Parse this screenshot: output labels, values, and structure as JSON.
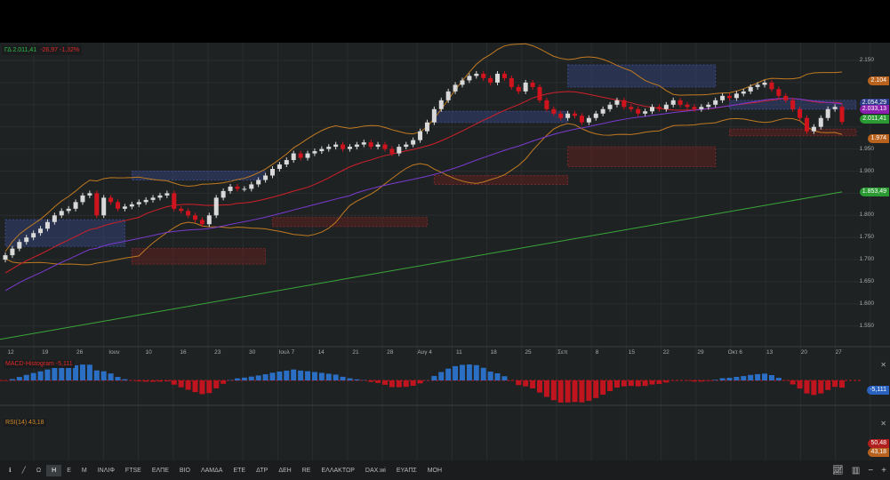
{
  "header": {
    "symbol_value": "ΓΔ 2.011,41",
    "change": "-26,97 -1,32%"
  },
  "price_axis": {
    "ticks": [
      "2.150",
      "1.950",
      "1.900",
      "1.800",
      "1.750",
      "1.700",
      "1.650",
      "1.600",
      "1.550"
    ],
    "tick_values": [
      2150,
      1950,
      1900,
      1800,
      1750,
      1700,
      1650,
      1600,
      1550
    ]
  },
  "price_tags": [
    {
      "text": "2.104",
      "value": 2104,
      "color": "#b8621e"
    },
    {
      "text": "2.054,29",
      "value": 2054,
      "color": "#2c3a8a"
    },
    {
      "text": "2.033,13",
      "value": 2040,
      "color": "#8a1fb0"
    },
    {
      "text": "2.011,41",
      "value": 2018,
      "color": "#2a9a32"
    },
    {
      "text": "1.974",
      "value": 1974,
      "color": "#b8621e"
    },
    {
      "text": "1.853,49",
      "value": 1853,
      "color": "#2a9a32"
    }
  ],
  "x_axis": {
    "labels": [
      "12",
      "19",
      "26",
      "Ιουν",
      "10",
      "16",
      "23",
      "30",
      "Ιουλ 7",
      "14",
      "21",
      "28",
      "Αυγ 4",
      "11",
      "18",
      "25",
      "Σεπ",
      "8",
      "15",
      "22",
      "29",
      "Οκτ 6",
      "13",
      "20",
      "27"
    ]
  },
  "macd": {
    "label": "MACD-Histogram -5,111",
    "tag": "-5,111",
    "tag_color": "#2a62c0"
  },
  "rsi": {
    "label": "RSI(14) 43,18",
    "tags": [
      {
        "text": "50,48",
        "color": "#b01e1e"
      },
      {
        "text": "43,18",
        "color": "#b8621e"
      }
    ],
    "levels": [
      70,
      30
    ]
  },
  "colors": {
    "up": "#d9d9d9",
    "down": "#d0141e",
    "sma20": "#d0202a",
    "sma50": "#7a3ad0",
    "bollinger": "#c07a20",
    "sma200": "#3aa83a",
    "macd_pos": "#2a6fc4",
    "macd_neg": "#c0141e"
  },
  "toolbar": {
    "items": [
      "Ω",
      "Η",
      "Ε",
      "Μ",
      "ΙΝΛΙΦ",
      "FTSE",
      "ΕΛΠΕ",
      "ΒΙΟ",
      "ΛΑΜΔΑ",
      "ΕΤΕ",
      "ΔΤΡ",
      "ΔΕΗ",
      "RE",
      "ΕΛΛΑΚΤΩΡ",
      "DAX.wi",
      "ΕΥΑΠΣ",
      "ΜΟΗ"
    ],
    "active": "Η",
    "icons": [
      "info-icon",
      "draw-line-icon"
    ],
    "right_icons": [
      "chart-type-icon",
      "indicators-icon",
      "zoom-out-icon",
      "zoom-in-icon"
    ]
  },
  "chart_data": {
    "type": "candlestick",
    "closes": [
      1710,
      1725,
      1740,
      1750,
      1760,
      1770,
      1785,
      1800,
      1810,
      1815,
      1830,
      1845,
      1850,
      1800,
      1840,
      1830,
      1815,
      1820,
      1825,
      1830,
      1835,
      1840,
      1845,
      1850,
      1815,
      1810,
      1800,
      1790,
      1780,
      1800,
      1840,
      1855,
      1865,
      1860,
      1860,
      1870,
      1880,
      1890,
      1905,
      1915,
      1925,
      1940,
      1930,
      1940,
      1945,
      1950,
      1955,
      1960,
      1950,
      1955,
      1960,
      1965,
      1955,
      1960,
      1950,
      1940,
      1955,
      1960,
      1970,
      1990,
      2010,
      2040,
      2060,
      2080,
      2095,
      2105,
      2115,
      2120,
      2110,
      2100,
      2120,
      2110,
      2090,
      2080,
      2100,
      2090,
      2060,
      2040,
      2030,
      2020,
      2030,
      2025,
      2010,
      2020,
      2030,
      2040,
      2050,
      2060,
      2045,
      2040,
      2030,
      2035,
      2045,
      2040,
      2050,
      2060,
      2050,
      2045,
      2040,
      2045,
      2050,
      2060,
      2070,
      2065,
      2075,
      2080,
      2090,
      2095,
      2100,
      2085,
      2070,
      2060,
      2040,
      2020,
      1990,
      2000,
      2020,
      2040,
      2045,
      2011
    ],
    "sma200": [
      1520,
      1853
    ],
    "zones": [
      {
        "from": 0,
        "to": 17,
        "low": 1730,
        "high": 1790,
        "kind": "supply"
      },
      {
        "from": 18,
        "to": 37,
        "low": 1880,
        "high": 1900,
        "kind": "supply"
      },
      {
        "from": 18,
        "to": 37,
        "low": 1690,
        "high": 1725,
        "kind": "demand"
      },
      {
        "from": 38,
        "to": 60,
        "low": 1775,
        "high": 1795,
        "kind": "demand"
      },
      {
        "from": 61,
        "to": 80,
        "low": 2010,
        "high": 2035,
        "kind": "supply"
      },
      {
        "from": 61,
        "to": 80,
        "low": 1870,
        "high": 1890,
        "kind": "demand"
      },
      {
        "from": 80,
        "to": 101,
        "low": 2090,
        "high": 2140,
        "kind": "supply"
      },
      {
        "from": 80,
        "to": 101,
        "low": 1910,
        "high": 1955,
        "kind": "demand"
      },
      {
        "from": 103,
        "to": 121,
        "low": 2040,
        "high": 2060,
        "kind": "supply"
      },
      {
        "from": 103,
        "to": 121,
        "low": 1980,
        "high": 1995,
        "kind": "demand"
      }
    ],
    "ylim": [
      1520,
      2175
    ]
  }
}
